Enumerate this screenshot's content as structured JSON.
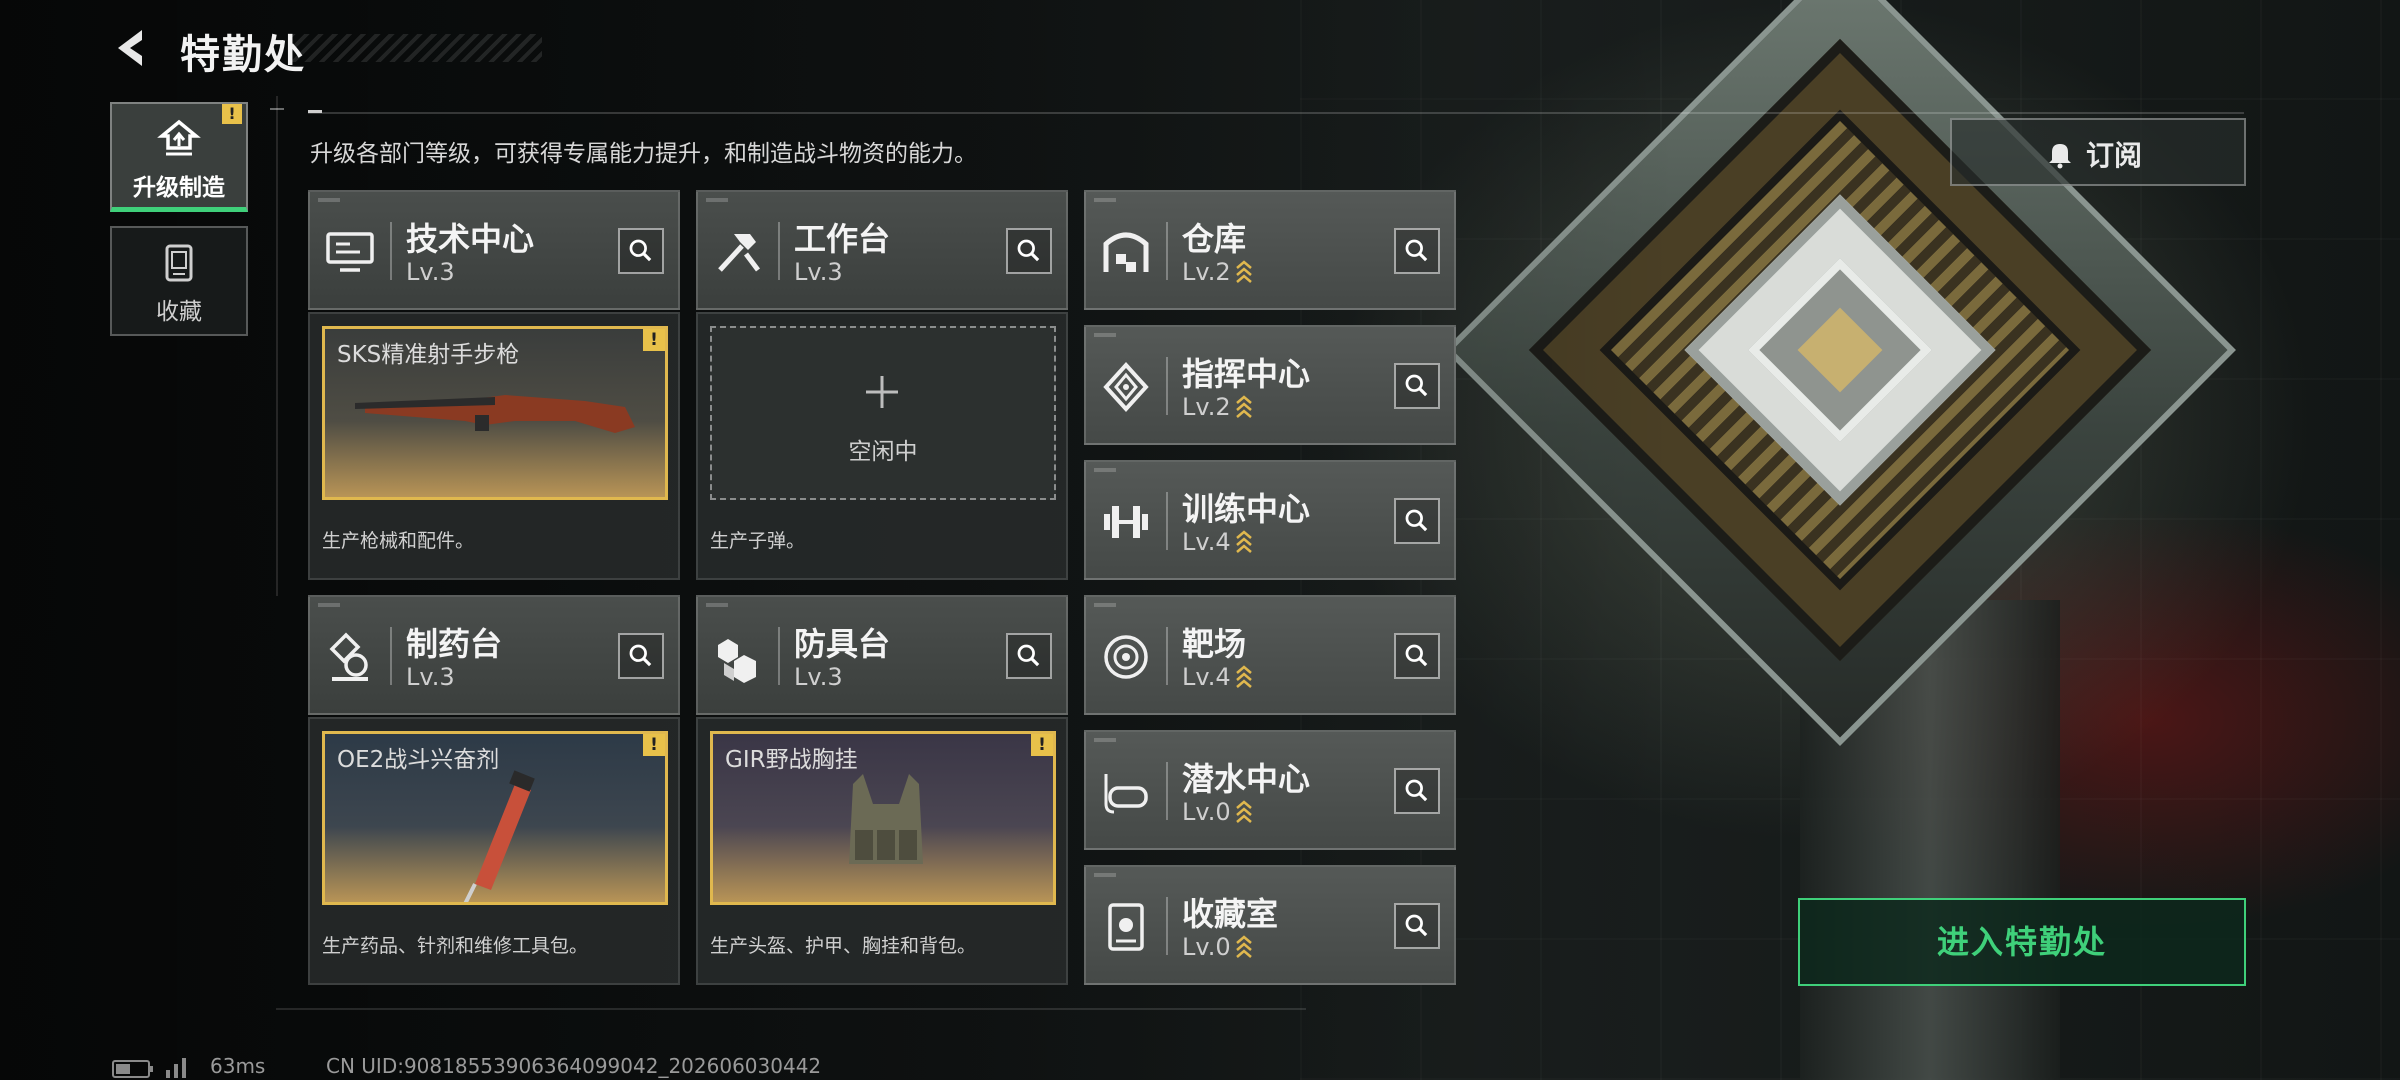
{
  "header": {
    "title": "特勤处",
    "description": "升级各部门等级，可获得专属能力提升，和制造战斗物资的能力。"
  },
  "nav": {
    "items": [
      {
        "label": "升级制造",
        "icon": "upgrade-build-icon",
        "badge": "!",
        "active": true
      },
      {
        "label": "收藏",
        "icon": "collection-icon",
        "active": false
      }
    ]
  },
  "departments": [
    {
      "name": "技术中心",
      "level": "Lv.3",
      "icon": "tech-center-icon"
    },
    {
      "name": "工作台",
      "level": "Lv.3",
      "icon": "workbench-icon"
    },
    {
      "name": "仓库",
      "level": "Lv.2",
      "icon": "warehouse-icon",
      "upgradable": true
    },
    {
      "name": "指挥中心",
      "level": "Lv.2",
      "icon": "command-center-icon",
      "upgradable": true
    },
    {
      "name": "训练中心",
      "level": "Lv.4",
      "icon": "training-center-icon",
      "upgradable": true
    },
    {
      "name": "制药台",
      "level": "Lv.3",
      "icon": "pharmacy-icon"
    },
    {
      "name": "防具台",
      "level": "Lv.3",
      "icon": "armor-bench-icon"
    },
    {
      "name": "靶场",
      "level": "Lv.4",
      "icon": "shooting-range-icon",
      "upgradable": true
    },
    {
      "name": "潜水中心",
      "level": "Lv.0",
      "icon": "diving-center-icon",
      "upgradable": true
    },
    {
      "name": "收藏室",
      "level": "Lv.0",
      "icon": "collection-room-icon",
      "upgradable": true
    }
  ],
  "production": [
    {
      "item_name": "SKS精准射手步枪",
      "description": "生产枪械和配件。",
      "badge": "!",
      "icon": "rifle-icon"
    },
    {
      "item_name": "",
      "status": "空闲中",
      "description": "生产子弹。",
      "icon": "plus-icon"
    },
    {
      "item_name": "OE2战斗兴奋剂",
      "description": "生产药品、针剂和维修工具包。",
      "badge": "!",
      "icon": "injector-icon"
    },
    {
      "item_name": "GIR野战胸挂",
      "description": "生产头盔、护甲、胸挂和背包。",
      "badge": "!",
      "icon": "chest-rig-icon"
    }
  ],
  "actions": {
    "subscribe_label": "订阅",
    "enter_label": "进入特勤处"
  },
  "footer": {
    "ping": "63ms",
    "uid": "CN UID:9081855390636409904​2_202606030442"
  },
  "colors": {
    "accent_green": "#3fd07a",
    "badge_yellow": "#e8c14a",
    "slot_gold": "#e0b84e"
  }
}
